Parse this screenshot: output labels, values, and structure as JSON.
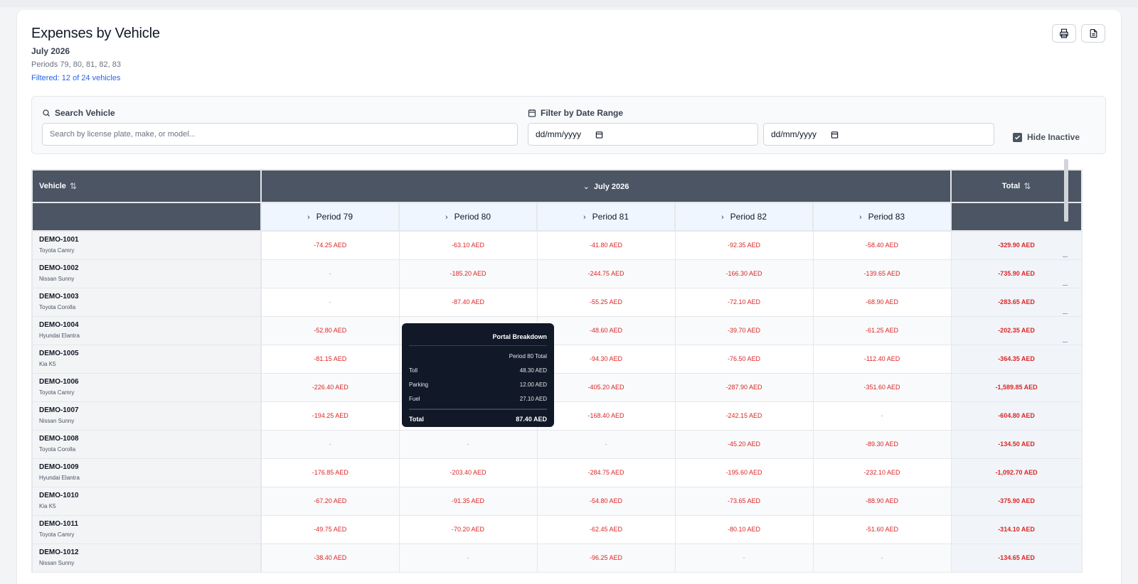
{
  "header": {
    "title": "Expenses by Vehicle",
    "month": "July 2026",
    "periods": "Periods 79, 80, 81, 82, 83",
    "filtered": "Filtered: 12 of 24 vehicles"
  },
  "actions": {
    "print_icon": "printer-icon",
    "export_icon": "document-icon"
  },
  "filters": {
    "search_label": "Search Vehicle",
    "search_placeholder": "Search by license plate, make, or model...",
    "date_label": "Filter by Date Range",
    "date_from": "dd/mm/yyyy",
    "date_to": "dd/mm/yyyy",
    "hide_inactive_label": "Hide Inactive",
    "hide_inactive_checked": true
  },
  "table": {
    "vehicle_header": "Vehicle",
    "month_header": "July 2026",
    "total_header": "Total",
    "periods": [
      "Period 79",
      "Period 80",
      "Period 81",
      "Period 82",
      "Period 83"
    ],
    "rows": [
      {
        "id": "DEMO-1001",
        "model": "Toyota Camry",
        "values": [
          "-74.25 AED",
          "-63.10 AED",
          "-41.80 AED",
          "-92.35 AED",
          "-58.40 AED"
        ],
        "total": "-329.90 AED"
      },
      {
        "id": "DEMO-1002",
        "model": "Nissan Sunny",
        "values": [
          "-",
          "-185.20 AED",
          "-244.75 AED",
          "-166.30 AED",
          "-139.65 AED"
        ],
        "total": "-735.90 AED"
      },
      {
        "id": "DEMO-1003",
        "model": "Toyota Corolla",
        "values": [
          "-",
          "-87.40 AED",
          "-55.25 AED",
          "-72.10 AED",
          "-68.90 AED"
        ],
        "total": "-283.65 AED"
      },
      {
        "id": "DEMO-1004",
        "model": "Hyundai Elantra",
        "values": [
          "-52.80 AED",
          "",
          "-48.60 AED",
          "-39.70 AED",
          "-61.25 AED"
        ],
        "total": "-202.35 AED"
      },
      {
        "id": "DEMO-1005",
        "model": "Kia K5",
        "values": [
          "-81.15 AED",
          "",
          "-94.30 AED",
          "-76.50 AED",
          "-112.40 AED"
        ],
        "total": "-364.35 AED"
      },
      {
        "id": "DEMO-1006",
        "model": "Toyota Camry",
        "values": [
          "-226.40 AED",
          "",
          "-405.20 AED",
          "-287.90 AED",
          "-351.60 AED"
        ],
        "total": "-1,589.85 AED"
      },
      {
        "id": "DEMO-1007",
        "model": "Nissan Sunny",
        "values": [
          "-194.25 AED",
          "",
          "-168.40 AED",
          "-242.15 AED",
          "-"
        ],
        "total": "-604.80 AED"
      },
      {
        "id": "DEMO-1008",
        "model": "Toyota Corolla",
        "values": [
          "-",
          "-",
          "-",
          "-45.20 AED",
          "-89.30 AED"
        ],
        "total": "-134.50 AED"
      },
      {
        "id": "DEMO-1009",
        "model": "Hyundai Elantra",
        "values": [
          "-176.85 AED",
          "-203.40 AED",
          "-284.75 AED",
          "-195.60 AED",
          "-232.10 AED"
        ],
        "total": "-1,092.70 AED"
      },
      {
        "id": "DEMO-1010",
        "model": "Kia K5",
        "values": [
          "-67.20 AED",
          "-91.35 AED",
          "-54.80 AED",
          "-73.65 AED",
          "-88.90 AED"
        ],
        "total": "-375.90 AED"
      },
      {
        "id": "DEMO-1011",
        "model": "Toyota Camry",
        "values": [
          "-49.75 AED",
          "-70.20 AED",
          "-62.45 AED",
          "-80.10 AED",
          "-51.60 AED"
        ],
        "total": "-314.10 AED"
      },
      {
        "id": "DEMO-1012",
        "model": "Nissan Sunny",
        "values": [
          "-38.40 AED",
          "-",
          "-96.25 AED",
          "-",
          "-"
        ],
        "total": "-134.65 AED"
      }
    ]
  },
  "tooltip": {
    "title": "Portal Breakdown",
    "subtitle": "Period 80 Total",
    "items": [
      {
        "label": "Toll",
        "value": "48.30 AED"
      },
      {
        "label": "Parking",
        "value": "12.00 AED"
      },
      {
        "label": "Fuel",
        "value": "27.10 AED"
      }
    ],
    "total_label": "Total",
    "total_value": "87.40 AED"
  }
}
